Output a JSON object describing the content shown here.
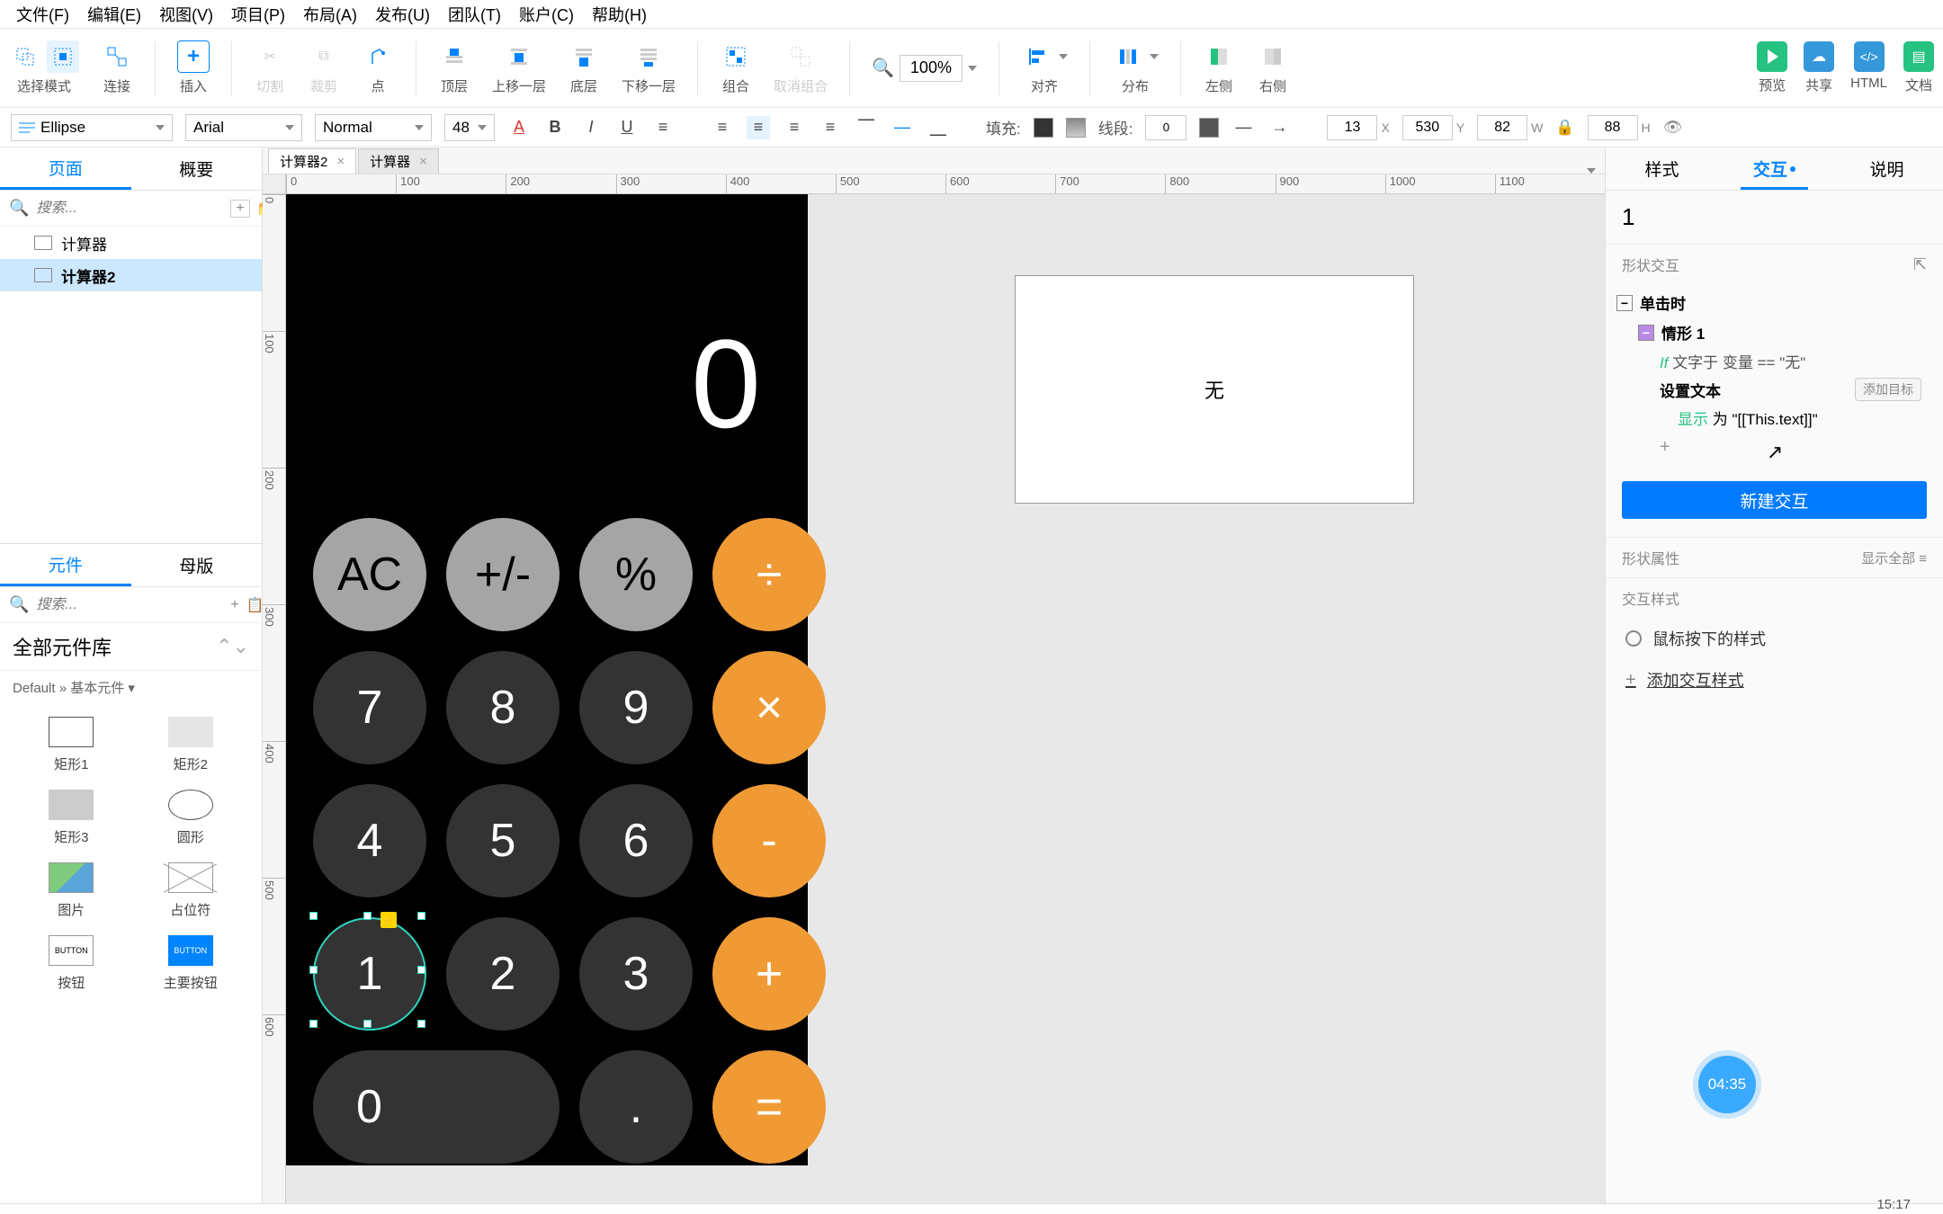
{
  "menu": [
    "文件(F)",
    "编辑(E)",
    "视图(V)",
    "项目(P)",
    "布局(A)",
    "发布(U)",
    "团队(T)",
    "账户(C)",
    "帮助(H)"
  ],
  "toolbar": {
    "select": "选择模式",
    "connect": "连接",
    "insert": "插入",
    "cut": "切割",
    "crop": "裁剪",
    "point": "点",
    "front": "顶层",
    "forward": "上移一层",
    "backward": "底层",
    "back": "下移一层",
    "group": "组合",
    "ungroup": "取消组合",
    "zoom_value": "100%",
    "align": "对齐",
    "distribute": "分布",
    "left": "左侧",
    "right": "右侧"
  },
  "right_actions": {
    "preview": "预览",
    "share": "共享",
    "html": "HTML",
    "spec": "文档"
  },
  "propbar": {
    "shape": "Ellipse",
    "font": "Arial",
    "weight": "Normal",
    "size": "48",
    "fill": "填充:",
    "stroke": "线段:",
    "stroke_w": "0",
    "x": "13",
    "y": "530",
    "w": "82",
    "h": "88"
  },
  "left_tabs": {
    "pages": "页面",
    "outline": "概要"
  },
  "search_ph": "搜索...",
  "pages": [
    {
      "name": "计算器"
    },
    {
      "name": "计算器2"
    }
  ],
  "widget_tabs": {
    "widgets": "元件",
    "masters": "母版"
  },
  "lib_title": "全部元件库",
  "lib_sub": "Default » 基本元件 ▾",
  "widgets": [
    "矩形1",
    "矩形2",
    "矩形3",
    "圆形",
    "图片",
    "占位符",
    "按钮",
    "主要按钮"
  ],
  "open_tabs": [
    {
      "name": "计算器2"
    },
    {
      "name": "计算器"
    }
  ],
  "ruler_h": [
    "0",
    "100",
    "200",
    "300",
    "400",
    "500",
    "600",
    "700",
    "800",
    "900",
    "1000",
    "1100"
  ],
  "ruler_v": [
    "0",
    "100",
    "200",
    "300",
    "400",
    "500",
    "600"
  ],
  "calc": {
    "display": "0",
    "keys": [
      {
        "t": "AC",
        "c": "gray"
      },
      {
        "t": "+/-",
        "c": "gray"
      },
      {
        "t": "%",
        "c": "gray"
      },
      {
        "t": "÷",
        "c": "orange"
      },
      {
        "t": "7",
        "c": "dark"
      },
      {
        "t": "8",
        "c": "dark"
      },
      {
        "t": "9",
        "c": "dark"
      },
      {
        "t": "×",
        "c": "orange"
      },
      {
        "t": "4",
        "c": "dark"
      },
      {
        "t": "5",
        "c": "dark"
      },
      {
        "t": "6",
        "c": "dark"
      },
      {
        "t": "-",
        "c": "orange"
      },
      {
        "t": "1",
        "c": "dark",
        "sel": true
      },
      {
        "t": "2",
        "c": "dark"
      },
      {
        "t": "3",
        "c": "dark"
      },
      {
        "t": "+",
        "c": "orange"
      },
      {
        "t": "0",
        "c": "dark",
        "wide": true
      },
      {
        "t": ".",
        "c": "dark"
      },
      {
        "t": "=",
        "c": "orange"
      }
    ]
  },
  "text_box": "无",
  "right_tabs": {
    "style": "样式",
    "interact": "交互",
    "notes": "说明"
  },
  "widget_name": "1",
  "ix": {
    "section": "形状交互",
    "event": "单击时",
    "case": "情形 1",
    "cond_if": "If",
    "cond_text": "文字于 变量 == \"无\"",
    "action": "设置文本",
    "add_target": "添加目标",
    "show": "显示",
    "show_text": "为 \"[[This.text]]\"",
    "new": "新建交互"
  },
  "shape_props": {
    "title": "形状属性",
    "show_all": "显示全部"
  },
  "ix_styles": {
    "title": "交互样式",
    "mousedown": "鼠标按下的样式",
    "add": "添加交互样式"
  },
  "timer": "04:35",
  "taskbar_time": "15:17"
}
